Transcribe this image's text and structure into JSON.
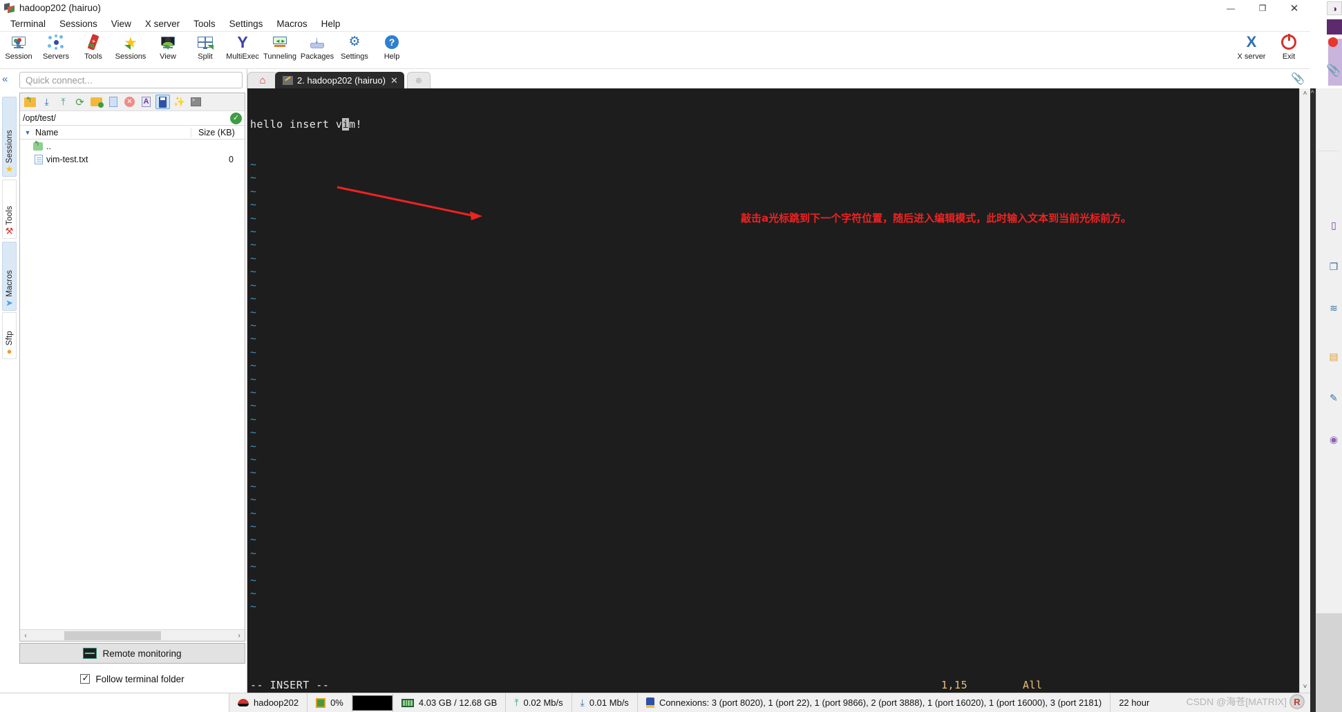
{
  "window": {
    "title": "hadoop202 (hairuo)",
    "icon": "mobaxterm-logo-icon",
    "controls": {
      "minimize": "—",
      "maximize": "❐",
      "close": "✕"
    }
  },
  "menubar": {
    "items": [
      "Terminal",
      "Sessions",
      "View",
      "X server",
      "Tools",
      "Settings",
      "Macros",
      "Help"
    ]
  },
  "toolbar": {
    "buttons": [
      {
        "label": "Session",
        "icon": "session-monitor-icon"
      },
      {
        "label": "Servers",
        "icon": "servers-network-icon"
      },
      {
        "label": "Tools",
        "icon": "swiss-knife-icon"
      },
      {
        "label": "Sessions",
        "icon": "star-icon"
      },
      {
        "label": "View",
        "icon": "view-monitor-icon"
      },
      {
        "label": "Split",
        "icon": "split-grid-icon"
      },
      {
        "label": "MultiExec",
        "icon": "multiexec-fork-icon"
      },
      {
        "label": "Tunneling",
        "icon": "tunneling-icon"
      },
      {
        "label": "Packages",
        "icon": "package-download-icon"
      },
      {
        "label": "Settings",
        "icon": "gear-icon"
      },
      {
        "label": "Help",
        "icon": "help-question-icon"
      }
    ],
    "right_buttons": [
      {
        "label": "X server",
        "icon": "x-server-icon"
      },
      {
        "label": "Exit",
        "icon": "power-exit-icon"
      }
    ]
  },
  "left_rail": {
    "collapse_icon": "chevron-double-left-icon",
    "tabs": [
      {
        "label": "Sessions",
        "icon": "star-icon"
      },
      {
        "label": "Tools",
        "icon": "swiss-knife-icon"
      },
      {
        "label": "Macros",
        "icon": "paper-plane-icon"
      },
      {
        "label": "Sftp",
        "icon": "globe-icon"
      }
    ]
  },
  "sidebar": {
    "quick_connect_placeholder": "Quick connect...",
    "sftp_toolbar": [
      {
        "icon": "folder-up-icon",
        "name": "parent-folder"
      },
      {
        "icon": "download-icon",
        "name": "download"
      },
      {
        "icon": "upload-icon",
        "name": "upload"
      },
      {
        "icon": "refresh-icon",
        "name": "refresh"
      },
      {
        "icon": "new-folder-icon",
        "name": "new-folder"
      },
      {
        "icon": "new-file-icon",
        "name": "new-file"
      },
      {
        "icon": "delete-icon",
        "name": "delete"
      },
      {
        "icon": "text-mode-icon",
        "name": "ascii-mode"
      },
      {
        "icon": "usb-drive-icon",
        "name": "follow-mode",
        "selected": true
      },
      {
        "icon": "magic-wand-icon",
        "name": "permissions"
      },
      {
        "icon": "terminal-icon",
        "name": "open-terminal"
      }
    ],
    "path": "/opt/test/",
    "path_ok_icon": "check-circle-icon",
    "columns": {
      "name": "Name",
      "size": "Size (KB)"
    },
    "files": [
      {
        "name": "..",
        "size": "",
        "icon": "folder-up-icon"
      },
      {
        "name": "vim-test.txt",
        "size": "0",
        "icon": "text-file-icon"
      }
    ],
    "remote_monitoring": {
      "label": "Remote monitoring",
      "icon": "monitor-graph-icon"
    },
    "follow_terminal_folder": {
      "label": "Follow terminal folder",
      "checked": true
    }
  },
  "tabs": {
    "home": {
      "icon": "home-icon"
    },
    "items": [
      {
        "label": "2. hadoop202 (hairuo)",
        "icon": "ssh-key-icon",
        "active": true,
        "close": "✕"
      }
    ],
    "new_tab": "⌾",
    "attach_icon": "paperclip-icon"
  },
  "terminal": {
    "first_line_prefix": "hello insert v",
    "cursor_char": "i",
    "first_line_suffix": "m!",
    "tilde": "~",
    "tilde_count": 34,
    "status_mode": "-- INSERT --",
    "ruler": "1,15",
    "position": "All",
    "annotation": "敲击a光标跳到下一个字符位置，随后进入编辑模式，此时输入文本到当前光标前方。",
    "annotation_color": "#f02222",
    "background": "#1d1d1d",
    "text_color": "#d8d8d8",
    "tilde_color": "#3f8fc0"
  },
  "statusbar": {
    "host": {
      "label": "hadoop202",
      "icon": "redhat-icon"
    },
    "cpu": {
      "label": "0%",
      "icon": "cpu-icon"
    },
    "graph": {
      "icon": "cpu-graph-box"
    },
    "memory": {
      "label": "4.03 GB / 12.68 GB",
      "icon": "ram-icon"
    },
    "upload": {
      "label": "0.02 Mb/s",
      "icon": "upload-arrow-icon"
    },
    "download": {
      "label": "0.01 Mb/s",
      "icon": "download-arrow-icon"
    },
    "connections": {
      "label": "Connexions: 3 (port 8020), 1 (port 22), 1 (port 9866), 2 (port 3888), 1 (port 16020), 1 (port 16000), 3 (port 2181)",
      "icon": "connections-icon"
    },
    "uptime": "22 hour",
    "watermark": "CSDN @海苍[MATRIX]"
  }
}
